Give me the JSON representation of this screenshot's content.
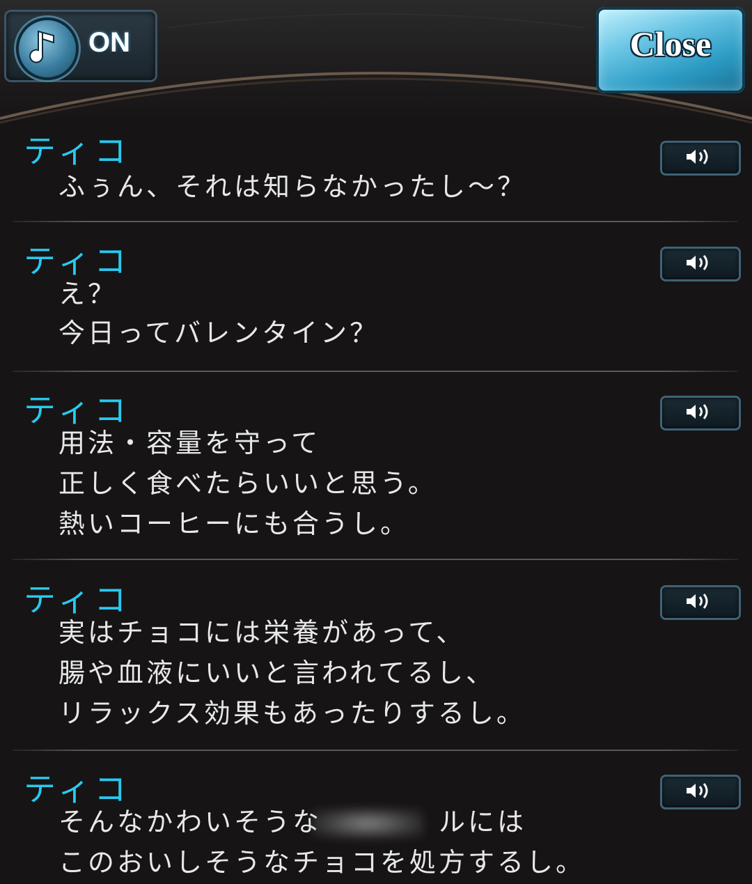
{
  "header": {
    "music_icon": "music-note-icon",
    "music_state": "ON",
    "close_label": "Close"
  },
  "log": [
    {
      "speaker": "ティコ",
      "lines": [
        "ふぅん、それは知らなかったし～？"
      ],
      "voice_icon": "speaker-icon"
    },
    {
      "speaker": "ティコ",
      "lines": [
        "え？",
        "今日ってバレンタイン？"
      ],
      "voice_icon": "speaker-icon"
    },
    {
      "speaker": "ティコ",
      "lines": [
        "用法・容量を守って",
        "正しく食べたらいいと思う。",
        "熱いコーヒーにも合うし。"
      ],
      "voice_icon": "speaker-icon"
    },
    {
      "speaker": "ティコ",
      "lines": [
        "実はチョコには栄養があって、",
        "腸や血液にいいと言われてるし、",
        "リラックス効果もあったりするし。"
      ],
      "voice_icon": "speaker-icon"
    },
    {
      "speaker": "ティコ",
      "lines": [
        "そんなかわいそうな　　　　ルには",
        "このおいしそうなチョコを処方するし。"
      ],
      "voice_icon": "speaker-icon"
    }
  ],
  "colors": {
    "speaker": "#28c9f0",
    "text": "#e8e8e8",
    "background": "#161414",
    "accent": "#2a9ac3"
  }
}
